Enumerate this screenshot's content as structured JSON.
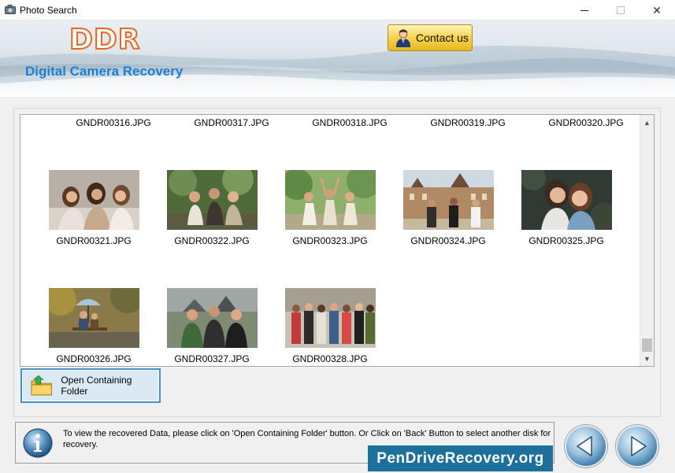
{
  "window": {
    "title": "Photo Search",
    "minimize_glyph": "",
    "maximize_glyph": "",
    "close_glyph": "✕"
  },
  "banner": {
    "logo": "DDR",
    "subtitle": "Digital Camera Recovery",
    "contact_label": "Contact us"
  },
  "gallery": {
    "top_row_labels": [
      "GNDR00316.JPG",
      "GNDR00317.JPG",
      "GNDR00318.JPG",
      "GNDR00319.JPG",
      "GNDR00320.JPG"
    ],
    "items": [
      {
        "file": "GNDR00321.JPG",
        "photo": "three-women-laughing"
      },
      {
        "file": "GNDR00322.JPG",
        "photo": "women-sitting-park"
      },
      {
        "file": "GNDR00323.JPG",
        "photo": "women-dancing-outdoors"
      },
      {
        "file": "GNDR00324.JPG",
        "photo": "men-in-front-of-castle"
      },
      {
        "file": "GNDR00325.JPG",
        "photo": "two-women-hugging"
      },
      {
        "file": "GNDR00326.JPG",
        "photo": "people-on-bench-umbrella"
      },
      {
        "file": "GNDR00327.JPG",
        "photo": "three-men-outdoors"
      },
      {
        "file": "GNDR00328.JPG",
        "photo": "group-with-phones"
      }
    ]
  },
  "actions": {
    "open_folder_label": "Open Containing Folder"
  },
  "info": {
    "message": "To view the recovered Data, please click on 'Open Containing Folder' button. Or Click on 'Back' Button to select another disk for recovery.",
    "watermark": "PenDriveRecovery.org"
  },
  "colors": {
    "accent_blue": "#1e7fd0",
    "logo_orange": "#e5671f",
    "contact_gold": "#f7d34c",
    "watermark_bg": "#1d6f9c"
  }
}
